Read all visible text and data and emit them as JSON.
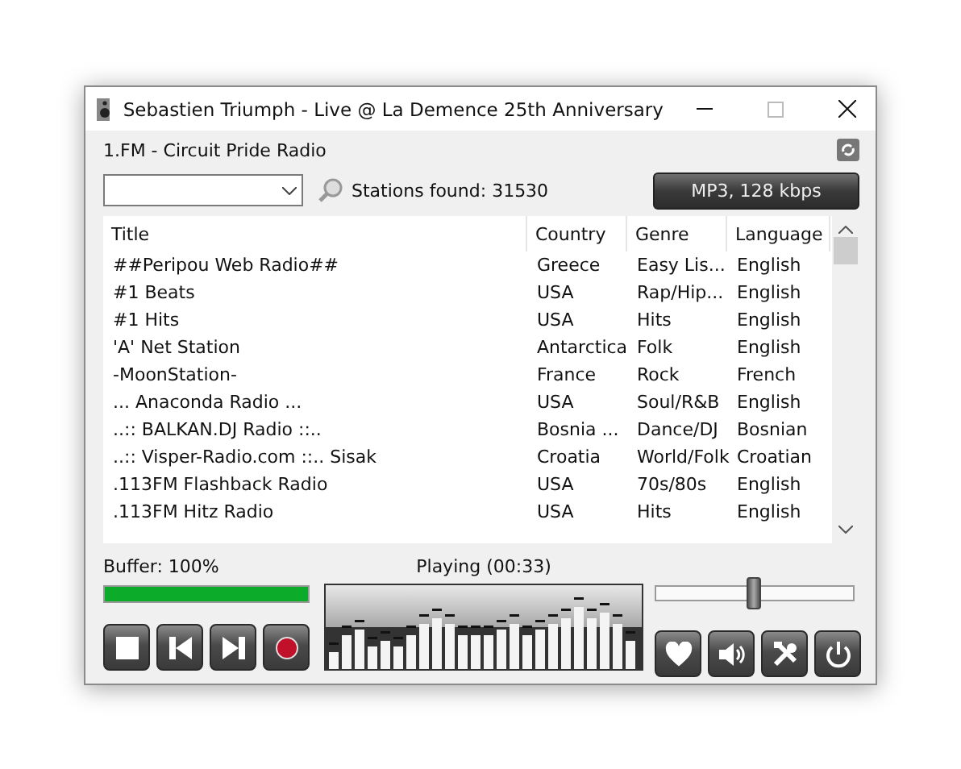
{
  "window": {
    "title": "Sebastien Triumph - Live @ La Demence 25th Anniversary"
  },
  "station": "1.FM - Circuit Pride Radio",
  "stations_found": "Stations found: 31530",
  "format_button": "MP3, 128 kbps",
  "table": {
    "columns": [
      "Title",
      "Country",
      "Genre",
      "Language"
    ],
    "rows": [
      [
        "##Peripou Web Radio##",
        "Greece",
        "Easy Lis...",
        "English"
      ],
      [
        "#1 Beats",
        "USA",
        "Rap/Hip...",
        "English"
      ],
      [
        "#1 Hits",
        "USA",
        "Hits",
        "English"
      ],
      [
        "'A' Net Station",
        "Antarctica",
        "Folk",
        "English"
      ],
      [
        "-MoonStation-",
        "France",
        "Rock",
        "French"
      ],
      [
        "... Anaconda Radio ...",
        "USA",
        "Soul/R&B",
        "English"
      ],
      [
        "..:: BALKAN.DJ Radio ::..",
        "Bosnia ...",
        "Dance/DJ",
        "Bosnian"
      ],
      [
        "..:: Visper-Radio.com ::.. Sisak",
        "Croatia",
        "World/Folk",
        "Croatian"
      ],
      [
        ".113FM Flashback Radio",
        "USA",
        "70s/80s",
        "English"
      ],
      [
        ".113FM Hitz Radio",
        "USA",
        "Hits",
        "English"
      ]
    ]
  },
  "buffer": {
    "label": "Buffer: 100%",
    "level": 1
  },
  "status": "Playing (00:33)",
  "volume": {
    "level": 0.5
  },
  "player_buttons": [
    {
      "kind": "stop"
    },
    {
      "kind": "previous"
    },
    {
      "kind": "next"
    },
    {
      "kind": "record"
    }
  ],
  "tool_buttons": [
    {
      "kind": "favorite"
    },
    {
      "kind": "volume"
    },
    {
      "kind": "tools"
    },
    {
      "kind": "power"
    }
  ]
}
